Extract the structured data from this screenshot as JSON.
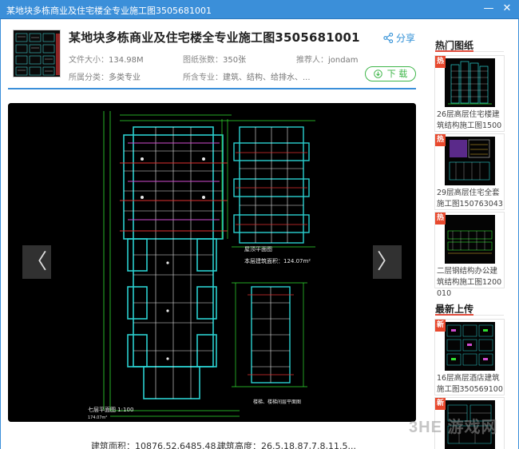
{
  "window": {
    "title": "某地块多栋商业及住宅楼全专业施工图3505681001",
    "minimize_glyph": "—",
    "close_glyph": "✕"
  },
  "detail": {
    "title": "某地块多栋商业及住宅楼全专业施工图3505681001",
    "share_label": "分享",
    "meta": [
      {
        "label": "文件大小：",
        "value": "134.98M"
      },
      {
        "label": "图纸张数：",
        "value": "350张"
      },
      {
        "label": "推荐人：",
        "value": "jondam"
      },
      {
        "label": "所属分类：",
        "value": "多类专业"
      },
      {
        "label": "所含专业：",
        "value": "建筑、结构、给排水、..."
      }
    ],
    "download_label": "下 载"
  },
  "viewer": {
    "prev_glyph": "〈",
    "next_glyph": "〉",
    "drawing_labels": {
      "floor_plan": "七层平面图 1:100",
      "area_text": "174.07m²",
      "top_plan": "屋顶平面图",
      "unit_area": "本层建筑面积：124.07m²",
      "stair_plan": "楼梯、楼梯间层平面图"
    }
  },
  "bottom_info": {
    "area": "建筑面积：10876.52,6485.48,...",
    "height": "建筑高度：26.5,18.87,7.8,11.5..."
  },
  "sidebar": {
    "hot_title": "热门图纸",
    "hot_items": [
      {
        "badge": "热",
        "label": "26层高层住宅楼建筑结构施工图1500500"
      },
      {
        "badge": "热",
        "label": "29层高层住宅全套施工图1507630430"
      },
      {
        "badge": "热",
        "label": "二层钢结构办公建筑结构施工图1200010"
      }
    ],
    "new_title": "最新上传",
    "new_items": [
      {
        "badge": "新",
        "label": "16层高层酒店建筑施工图3505691001"
      },
      {
        "badge": "新",
        "label": ""
      }
    ]
  },
  "watermark": "3HE 游戏网",
  "colors": {
    "accent_blue": "#3b8fd9",
    "download_green": "#3fb64a",
    "hot_red": "#e8492e"
  }
}
